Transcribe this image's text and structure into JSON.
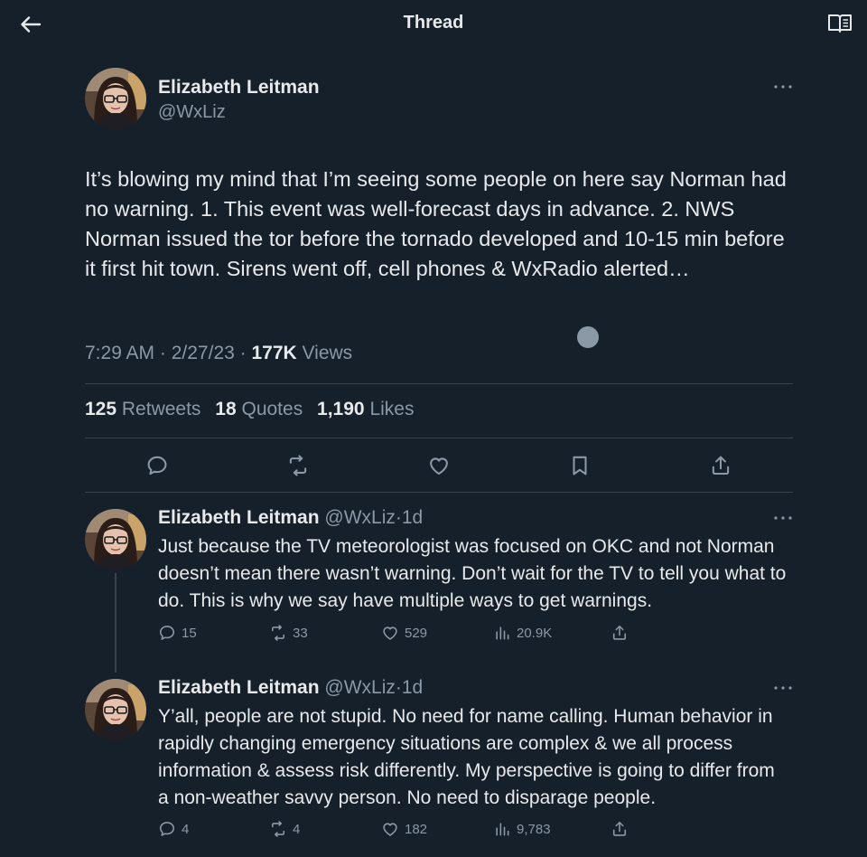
{
  "header": {
    "title": "Thread"
  },
  "main_tweet": {
    "author_name": "Elizabeth Leitman",
    "handle": "@WxLiz",
    "text": "It’s blowing my mind that I’m seeing some people on here say Norman had no warning. 1. This event was well-forecast days in advance. 2. NWS Norman issued the tor before the tornado developed and 10-15 min before it first hit town. Sirens went off, cell phones & WxRadio alerted…",
    "time": "7:29 AM",
    "date": "2/27/23",
    "views_count": "177K",
    "views_label": "Views",
    "retweets_count": "125",
    "retweets_label": "Retweets",
    "quotes_count": "18",
    "quotes_label": "Quotes",
    "likes_count": "1,190",
    "likes_label": "Likes"
  },
  "replies": [
    {
      "author_name": "Elizabeth Leitman",
      "handle": "@WxLiz",
      "age": "1d",
      "text": "Just because the TV meteorologist was focused on OKC and not Norman doesn’t mean there wasn’t warning. Don’t wait for the TV to tell you what to do. This is why we say have multiple ways to get warnings.",
      "replies": "15",
      "retweets": "33",
      "likes": "529",
      "views": "20.9K"
    },
    {
      "author_name": "Elizabeth Leitman",
      "handle": "@WxLiz",
      "age": "1d",
      "text": "Y’all, people are not stupid. No need for name calling. Human behavior in rapidly changing emergency situations are complex & we all process information & assess risk differently. My perspective is going to differ from a non-weather savvy person. No need to disparage people.",
      "replies": "4",
      "retweets": "4",
      "likes": "182",
      "views": "9,783"
    }
  ],
  "icons": {
    "back": "arrow-left-icon",
    "reader": "open-book-icon",
    "more": "more-horizontal-icon",
    "reply": "speech-bubble-icon",
    "retweet": "retweet-icon",
    "like": "heart-icon",
    "bookmark": "bookmark-icon",
    "share": "share-icon",
    "views": "bar-chart-icon"
  },
  "colors": {
    "background": "#15202b",
    "text": "#e7e9ea",
    "muted": "#8b98a5",
    "divider": "#38444d"
  }
}
